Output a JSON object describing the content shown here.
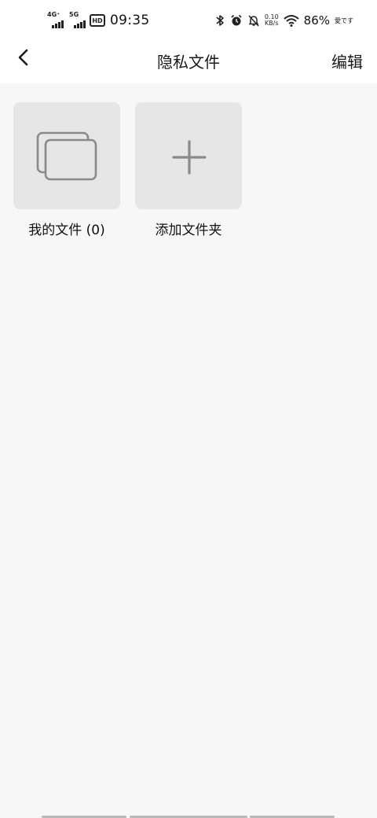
{
  "status_bar": {
    "network_1": "4G⁺",
    "network_2": "5G",
    "hd_badge": "HD",
    "time": "09:35",
    "speed_value": "0.10",
    "speed_unit": "KB/s",
    "battery": "86%",
    "carrier": "愛です"
  },
  "header": {
    "title": "隐私文件",
    "edit_label": "编辑"
  },
  "folders": [
    {
      "label": "我的文件 (0)",
      "icon": "folder-stack-icon"
    },
    {
      "label": "添加文件夹",
      "icon": "plus-icon"
    }
  ]
}
